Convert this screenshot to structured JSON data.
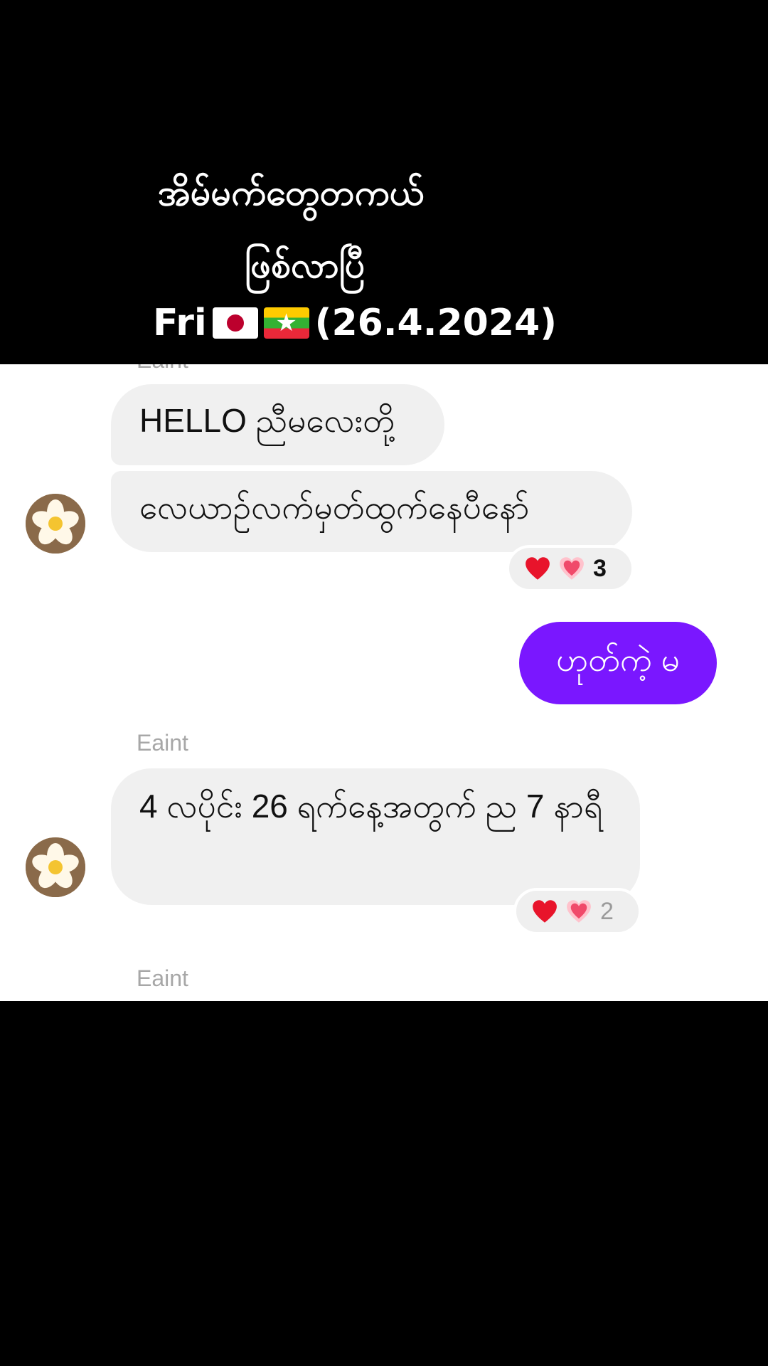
{
  "overlay": {
    "line1": "အိမ်မက်တွေတကယ်",
    "line2": "ဖြစ်လာပြီ",
    "day": "Fri",
    "date": "(26.4.2024)"
  },
  "messages": {
    "top_partial_name": "Eaint",
    "group1": {
      "msg1": "HELLO ညီမလေးတို့",
      "msg2": "လေယာဉ်လက်မှတ်ထွက်နေပီနော်",
      "reaction_count": "3"
    },
    "sent": {
      "text": "ဟုတ်ကဲ့ မ"
    },
    "group2": {
      "sender": "Eaint",
      "msg": "4 လပိုင်း 26 ရက်နေ့အတွက်  ည 7 နာရီ",
      "reaction_count": "2"
    },
    "bottom_name": "Eaint"
  },
  "colors": {
    "sent_bubble": "#7a17ff",
    "received_bubble": "#f0f0f0",
    "sender_name": "#a7a7a7"
  },
  "icons": [
    "red-heart-icon",
    "sparkling-heart-icon"
  ]
}
